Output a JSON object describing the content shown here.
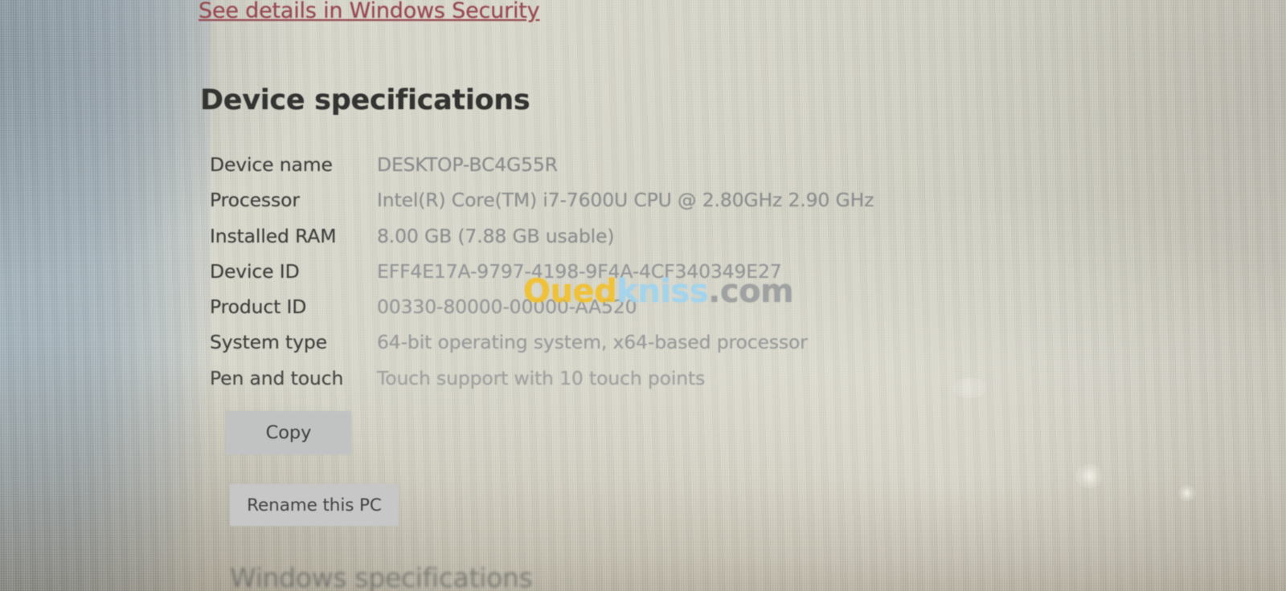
{
  "screen": {
    "security_link": "See details in Windows Security",
    "page_title": "Device specifications",
    "next_section_heading": "Windows specifications"
  },
  "specs": {
    "rows": [
      {
        "label": "Device name",
        "value": "DESKTOP-BC4G55R"
      },
      {
        "label": "Processor",
        "value": "Intel(R) Core(TM) i7-7600U CPU @ 2.80GHz   2.90 GHz"
      },
      {
        "label": "Installed RAM",
        "value": "8.00 GB (7.88 GB usable)"
      },
      {
        "label": "Device ID",
        "value": "EFF4E17A-9797-4198-9F4A-4CF340349E27"
      },
      {
        "label": "Product ID",
        "value": "00330-80000-00000-AA520"
      },
      {
        "label": "System type",
        "value": "64-bit operating system, x64-based processor"
      },
      {
        "label": "Pen and touch",
        "value": "Touch support with 10 touch points"
      }
    ]
  },
  "buttons": {
    "copy": "Copy",
    "rename_pc": "Rename this PC"
  },
  "watermark": {
    "part1": "Oued",
    "part2": "kniss",
    "part3": ".com"
  },
  "colors": {
    "screen_background": "#d7d6ca",
    "link_red": "#a14650",
    "label_text": "#3c3d3b",
    "value_text": "#8d9091",
    "button_fill": "#c3c6c6",
    "watermark_yellow": "#f2c02c",
    "watermark_blue": "#9fd4ef",
    "watermark_gray": "#9a9d9e"
  }
}
